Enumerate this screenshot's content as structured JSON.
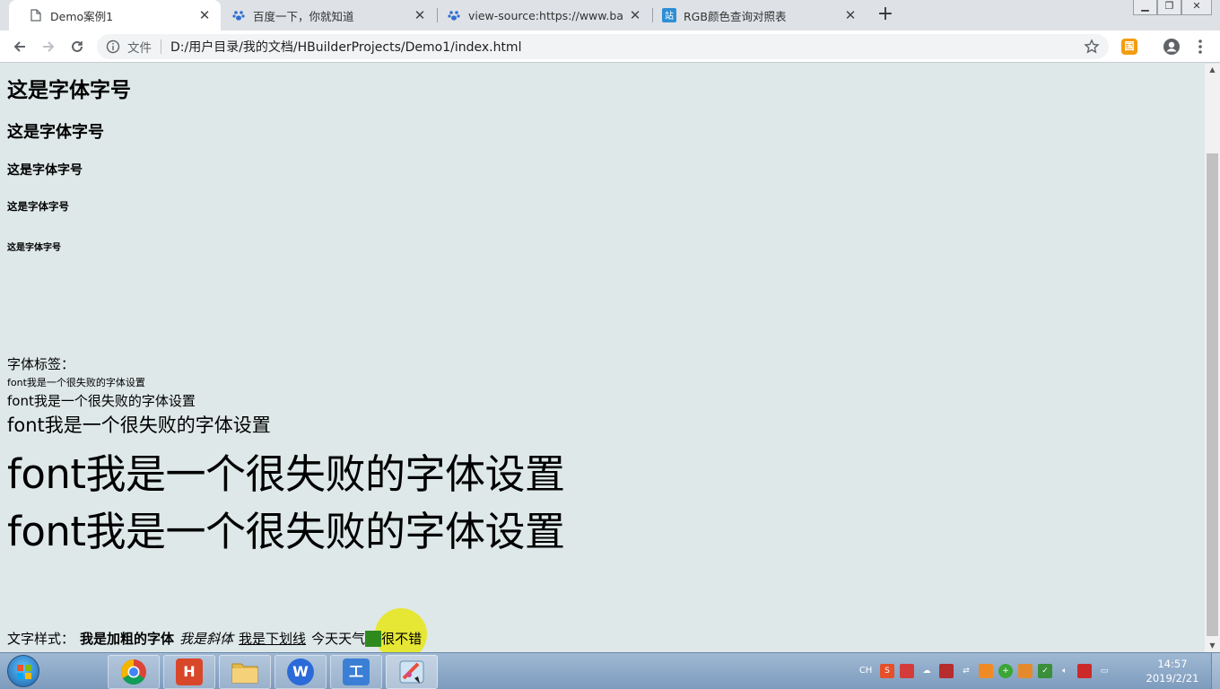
{
  "browser": {
    "tabs": [
      {
        "title": "Demo案例1",
        "icon": "page-icon"
      },
      {
        "title": "百度一下，你就知道",
        "icon": "baidu-paw-icon"
      },
      {
        "title": "view-source:https://www.baidu",
        "icon": "baidu-paw-icon"
      },
      {
        "title": "RGB颜色查询对照表",
        "icon": "rgb-site-icon"
      }
    ],
    "address": {
      "label": "文件",
      "url": "D:/用户目录/我的文档/HBuilderProjects/Demo1/index.html"
    },
    "extension_label": "国"
  },
  "page": {
    "headings": [
      "这是字体字号",
      "这是字体字号",
      "这是字体字号",
      "这是字体字号",
      "这是字体字号"
    ],
    "font_label": "字体标签：",
    "font_lines": [
      "font我是一个很失败的字体设置",
      "font我是一个很失败的字体设置",
      "font我是一个很失败的字体设置",
      "font我是一个很失败的字体设置",
      "font我是一个很失败的字体设置"
    ],
    "style_row": {
      "label": "文字样式：",
      "bold": "我是加粗的字体",
      "italic": "我是斜体",
      "underline": "我是下划线",
      "weather_before": "今天天气",
      "weather_after": "很不错"
    }
  },
  "taskbar": {
    "apps": [
      {
        "name": "chrome",
        "glyph": "",
        "color": "#4285f4"
      },
      {
        "name": "hbuilder",
        "glyph": "H",
        "color": "#d9472b"
      },
      {
        "name": "explorer",
        "glyph": "",
        "color": "#e6b94b"
      },
      {
        "name": "wps",
        "glyph": "W",
        "color": "#2b6bd9"
      },
      {
        "name": "worktool",
        "glyph": "工",
        "color": "#3a7fd5"
      },
      {
        "name": "paint",
        "glyph": "",
        "color": "#9ac0e0"
      }
    ],
    "tray_lang": "CH",
    "clock_time": "14:57",
    "clock_date": "2019/2/21"
  },
  "colors": {
    "page_bg": "#dee8e8",
    "highlight": "#e6e614",
    "green_box": "#2f8a1d"
  }
}
